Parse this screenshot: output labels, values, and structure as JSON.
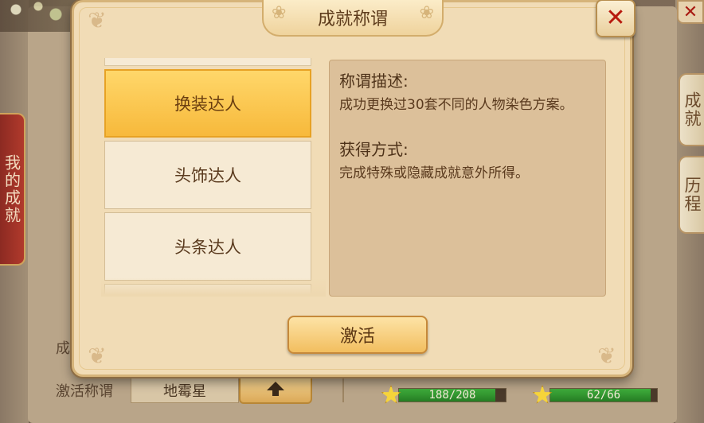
{
  "background": {
    "left_tab": "我的成就",
    "right_tabs": [
      "成就",
      "历程"
    ],
    "footer_label": "激活称谓",
    "footer_label_partial": "成",
    "current_title": "地霉星",
    "progress": [
      {
        "text": "188/208",
        "fraction": 0.904
      },
      {
        "text": "62/66",
        "fraction": 0.939
      }
    ]
  },
  "modal": {
    "title": "成就称谓",
    "list": [
      {
        "label": "换装达人",
        "selected": true
      },
      {
        "label": "头饰达人",
        "selected": false
      },
      {
        "label": "头条达人",
        "selected": false
      }
    ],
    "description": {
      "heading1": "称谓描述:",
      "text1": "成功更换过30套不同的人物染色方案。",
      "heading2": "获得方式:",
      "text2": "完成特殊或隐藏成就意外所得。"
    },
    "activate_label": "激活"
  },
  "colors": {
    "selected_item": "#f7b93b",
    "close_x": "#b81a0e",
    "progress_fill": "#3fae3c"
  },
  "icons": [
    "close-icon",
    "star-icon",
    "arrow-up-icon"
  ]
}
